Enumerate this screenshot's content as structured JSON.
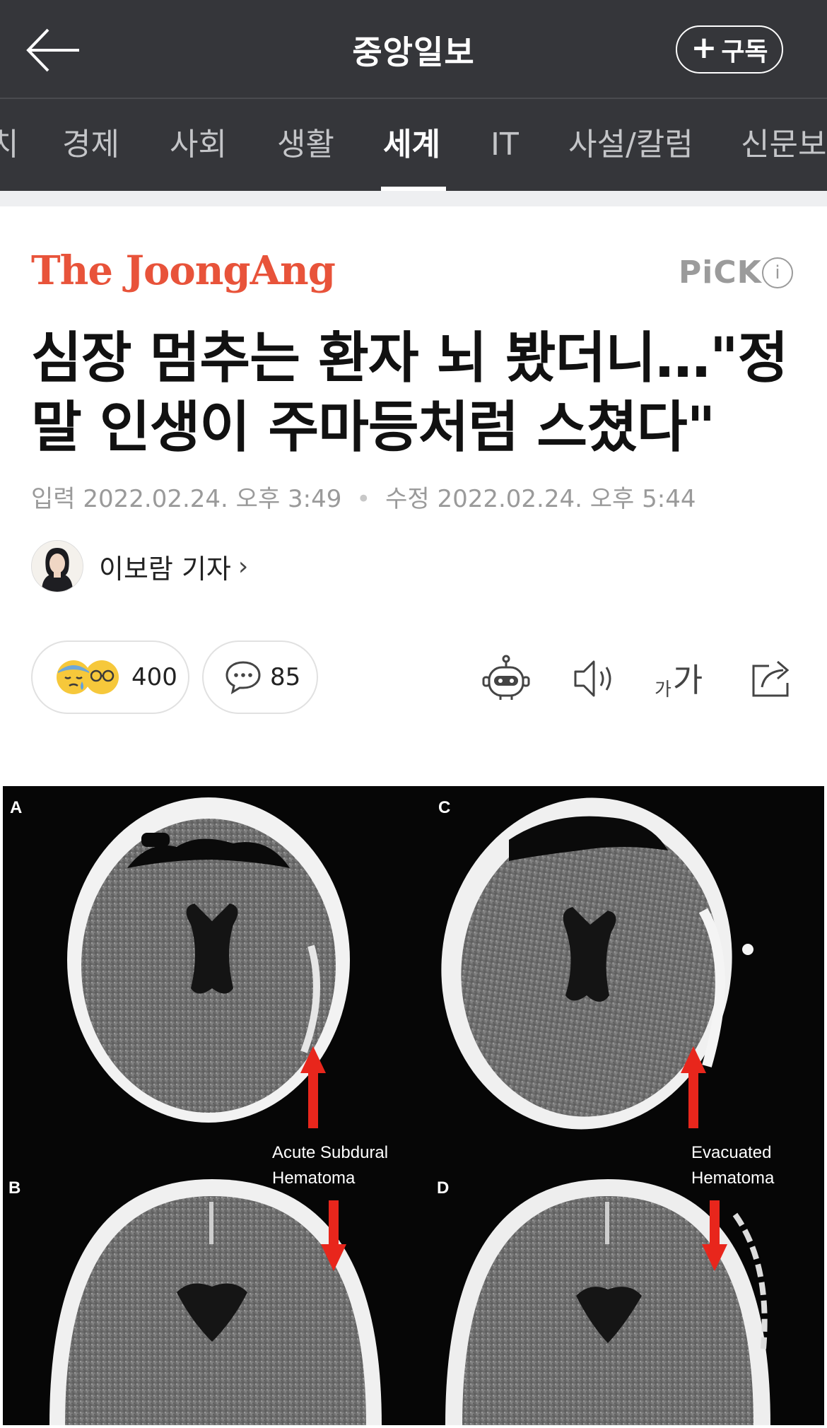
{
  "header": {
    "back_icon": "arrow-left-icon",
    "title": "중앙일보",
    "subscribe_label": "구독",
    "subscribe_icon": "plus-icon"
  },
  "nav": {
    "items": [
      "치",
      "경제",
      "사회",
      "생활",
      "세계",
      "IT",
      "사설/칼럼",
      "신문보"
    ],
    "active": "세계"
  },
  "article": {
    "logo": "The JoongAng",
    "pick_label": "PiCK",
    "headline_line1": "심장 멈추는 환자 뇌 봤더니…\"정",
    "headline_line2": "말 인생이 주마등처럼 스쳤다\"",
    "input_label": "입력",
    "input_date": "2022.02.24. 오후 3:49",
    "modified_label": "수정",
    "modified_date": "2022.02.24. 오후 5:44",
    "author": "이보람 기자"
  },
  "actions": {
    "reaction_count": "400",
    "comment_count": "85",
    "tools": [
      "robot-icon",
      "speaker-icon",
      "font-size-icon",
      "share-icon"
    ],
    "font_small": "가",
    "font_big": "가"
  },
  "figure": {
    "panel_a": "A",
    "panel_b": "B",
    "panel_c": "C",
    "panel_d": "D",
    "label_left_1": "Acute Subdural",
    "label_left_2": "Hematoma",
    "label_right_1": "Evacuated",
    "label_right_2": "Hematoma"
  },
  "colors": {
    "header_bg": "#35363a",
    "logo": "#e8533a",
    "arrow": "#e8261c"
  }
}
